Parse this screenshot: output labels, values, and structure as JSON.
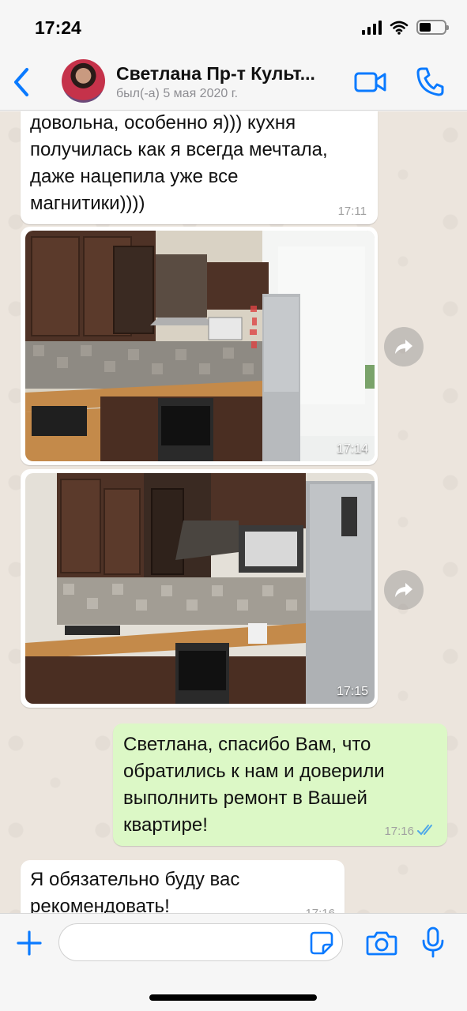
{
  "status_bar": {
    "time": "17:24",
    "icons": [
      "signal-icon",
      "wifi-icon",
      "battery-icon"
    ]
  },
  "header": {
    "back_icon": "chevron-left-icon",
    "contact_name": "Светлана Пр-т Культ...",
    "last_seen": "был(-а) 5 мая 2020 г.",
    "video_icon": "video-camera-icon",
    "call_icon": "phone-icon",
    "accent_color": "#0a7aff"
  },
  "messages": [
    {
      "type": "text",
      "direction": "incoming",
      "lines": [
        "довольна, особенно я))) кухня",
        "получилась как я всегда мечтала,",
        "даже нацепила уже все",
        "магнитики))))"
      ],
      "time": "17:11"
    },
    {
      "type": "image",
      "direction": "incoming",
      "description": "kitchen-photo-1",
      "time": "17:14",
      "forward_icon": "forward-arrow-icon"
    },
    {
      "type": "image",
      "direction": "incoming",
      "description": "kitchen-photo-2",
      "time": "17:15",
      "forward_icon": "forward-arrow-icon"
    },
    {
      "type": "text",
      "direction": "outgoing",
      "lines": [
        "Светлана, спасибо Вам, что",
        "обратились к нам и доверили",
        "выполнить ремонт в Вашей",
        "квартире!"
      ],
      "time": "17:16",
      "status": "read",
      "status_icon": "double-check-icon"
    },
    {
      "type": "text",
      "direction": "incoming",
      "lines": [
        "Я обязательно буду вас",
        "рекомендовать!"
      ],
      "time": "17:16"
    }
  ],
  "input_bar": {
    "plus_icon": "plus-icon",
    "placeholder": "",
    "value": "",
    "sticker_icon": "sticker-icon",
    "camera_icon": "camera-icon",
    "mic_icon": "microphone-icon"
  },
  "colors": {
    "incoming_bubble": "#ffffff",
    "outgoing_bubble": "#dcf8c6",
    "chat_background": "#ece5dd",
    "read_check": "#4fa8e8"
  }
}
